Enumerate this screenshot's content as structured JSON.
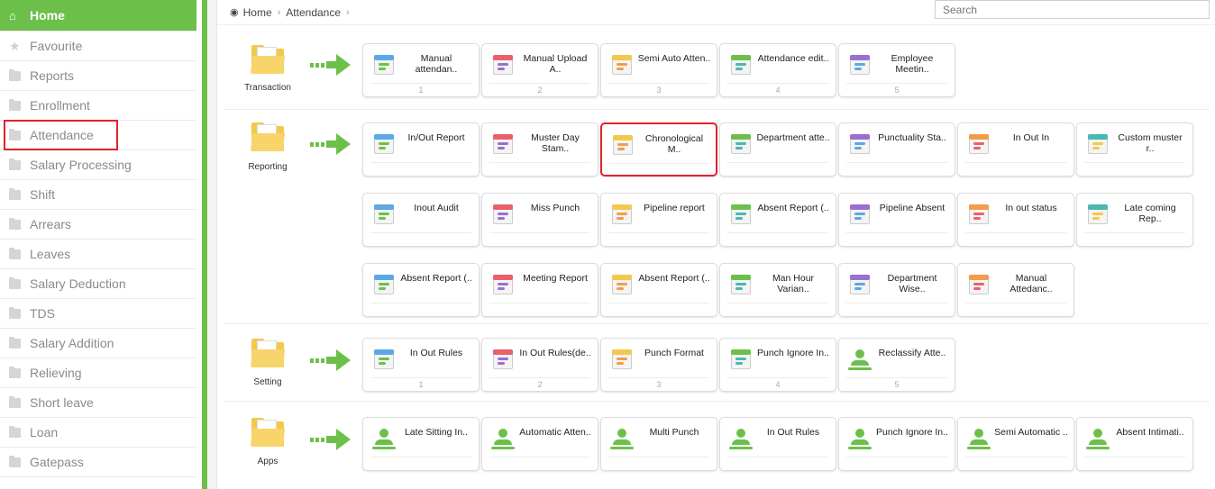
{
  "sidebar": {
    "items": [
      {
        "label": "Home",
        "icon": "home-icon"
      },
      {
        "label": "Favourite",
        "icon": "star-icon"
      },
      {
        "label": "Reports",
        "icon": "folder-icon"
      },
      {
        "label": "Enrollment",
        "icon": "folder-icon"
      },
      {
        "label": "Attendance",
        "icon": "folder-icon"
      },
      {
        "label": "Salary Processing",
        "icon": "folder-icon"
      },
      {
        "label": "Shift",
        "icon": "folder-icon"
      },
      {
        "label": "Arrears",
        "icon": "folder-icon"
      },
      {
        "label": "Leaves",
        "icon": "folder-icon"
      },
      {
        "label": "Salary Deduction",
        "icon": "folder-icon"
      },
      {
        "label": "TDS",
        "icon": "folder-icon"
      },
      {
        "label": "Salary Addition",
        "icon": "folder-icon"
      },
      {
        "label": "Relieving",
        "icon": "folder-icon"
      },
      {
        "label": "Short leave",
        "icon": "folder-icon"
      },
      {
        "label": "Loan",
        "icon": "folder-icon"
      },
      {
        "label": "Gatepass",
        "icon": "folder-icon"
      }
    ]
  },
  "breadcrumb": {
    "home": "Home",
    "current": "Attendance"
  },
  "search": {
    "placeholder": "Search"
  },
  "sections": {
    "transaction": {
      "label": "Transaction",
      "tiles": [
        {
          "label": "Manual attendan..",
          "num": "1",
          "icon": "calendar-check-icon"
        },
        {
          "label": "Manual Upload A..",
          "num": "2",
          "icon": "calendar-clock-icon"
        },
        {
          "label": "Semi Auto Atten..",
          "num": "3",
          "icon": "clock-machine-icon"
        },
        {
          "label": "Attendance edit..",
          "num": "4",
          "icon": "calendar-edit-icon"
        },
        {
          "label": "Employee Meetin..",
          "num": "5",
          "icon": "meeting-icon"
        }
      ]
    },
    "reporting": {
      "label": "Reporting",
      "tiles": [
        {
          "label": "In/Out Report",
          "icon": "report-clipboard-icon"
        },
        {
          "label": "Muster Day Stam..",
          "icon": "chart-report-icon"
        },
        {
          "label": "Chronological M..",
          "icon": "books-hourglass-icon"
        },
        {
          "label": "Department atte..",
          "icon": "department-list-icon"
        },
        {
          "label": "Punctuality Sta..",
          "icon": "punctuality-clock-icon"
        },
        {
          "label": "In Out In",
          "icon": "door-icon"
        },
        {
          "label": "Custom muster r..",
          "icon": "custom-report-icon"
        },
        {
          "label": "Inout Audit",
          "icon": "audit-clock-icon"
        },
        {
          "label": "Miss Punch",
          "icon": "hand-punch-icon"
        },
        {
          "label": "Pipeline report",
          "icon": "pipeline-icon"
        },
        {
          "label": "Absent Report (..",
          "icon": "absent-calendar-icon"
        },
        {
          "label": "Pipeline Absent",
          "icon": "pipeline-absent-icon"
        },
        {
          "label": "In out status",
          "icon": "status-bars-icon"
        },
        {
          "label": "Late coming Rep..",
          "icon": "late-runner-icon"
        },
        {
          "label": "Absent Report (..",
          "icon": "calendar-grid-icon"
        },
        {
          "label": "Meeting Report",
          "icon": "meeting-report-icon"
        },
        {
          "label": "Absent Report (..",
          "icon": "absent-person-icon"
        },
        {
          "label": "Man Hour Varian..",
          "icon": "chart-gear-icon"
        },
        {
          "label": "Department Wise..",
          "icon": "chart-gear-icon"
        },
        {
          "label": "Manual Attedanc..",
          "icon": "chart-gear-icon"
        }
      ]
    },
    "setting": {
      "label": "Setting",
      "tiles": [
        {
          "label": "In Out Rules",
          "num": "1",
          "icon": "rules-clock-icon"
        },
        {
          "label": "In Out Rules(de..",
          "num": "2",
          "icon": "building-clock-icon"
        },
        {
          "label": "Punch Format",
          "num": "3",
          "icon": "csv-file-icon"
        },
        {
          "label": "Punch Ignore In..",
          "num": "4",
          "icon": "person-clock-icon"
        },
        {
          "label": "Reclassify Atte..",
          "num": "5",
          "icon": "person-green-icon"
        }
      ]
    },
    "apps": {
      "label": "Apps",
      "tiles": [
        {
          "label": "Late Sitting In..",
          "icon": "person-green-icon"
        },
        {
          "label": "Automatic Atten..",
          "icon": "person-green-icon"
        },
        {
          "label": "Multi Punch",
          "icon": "person-green-icon"
        },
        {
          "label": "In Out Rules",
          "icon": "person-green-icon"
        },
        {
          "label": "Punch Ignore In..",
          "icon": "person-green-icon"
        },
        {
          "label": "Semi Automatic ..",
          "icon": "person-green-icon"
        },
        {
          "label": "Absent Intimati..",
          "icon": "person-green-icon"
        }
      ]
    }
  },
  "colors": {
    "accent": "#6cc04a",
    "highlight": "#e3202b",
    "folder": "#f2c94c"
  }
}
